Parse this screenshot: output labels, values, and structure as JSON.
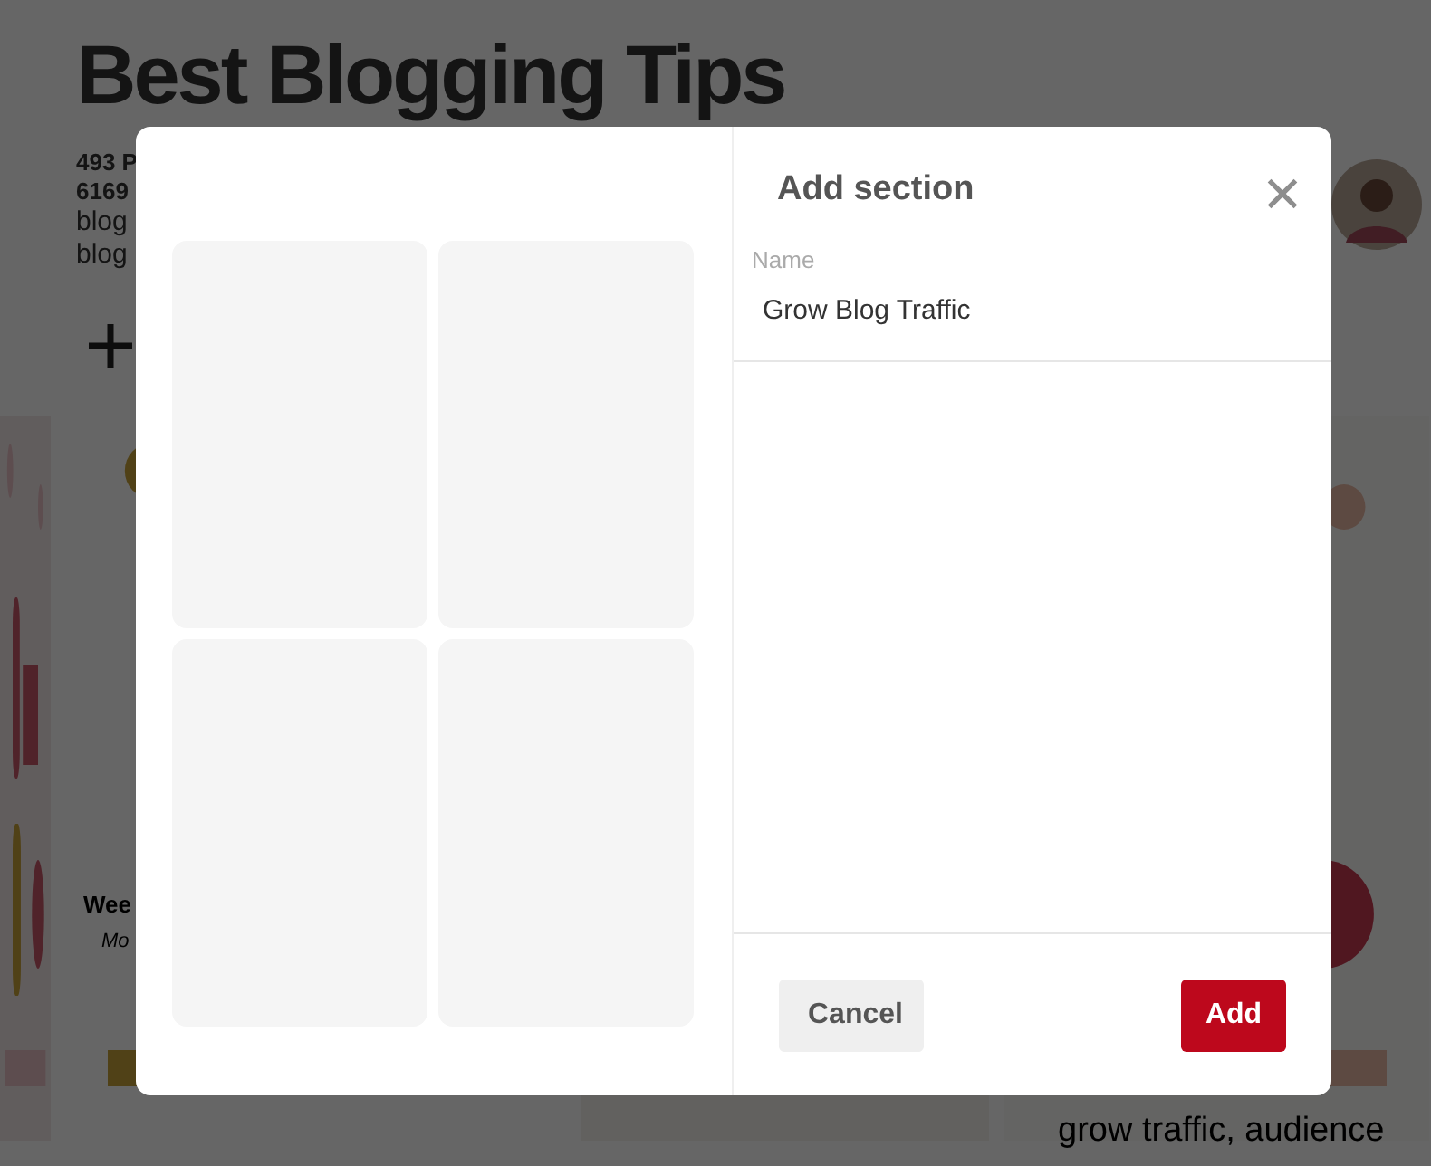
{
  "board": {
    "title": "Best Blogging Tips",
    "stats": [
      "493 P",
      "6169"
    ],
    "description_lines": [
      "blog",
      "blog"
    ],
    "pins": [
      {
        "kind": "picture"
      },
      {
        "kind": "picture",
        "title": "Wee",
        "subtitle": "Mo"
      },
      {
        "kind": "picture"
      },
      {
        "kind": "picture",
        "caption": "grow traffic, audience"
      }
    ]
  },
  "modal": {
    "title": "Add section",
    "field": {
      "label": "Name",
      "value": "Grow Blog Traffic"
    },
    "buttons": [
      {
        "label": "Cancel",
        "kind": "secondary"
      },
      {
        "label": "Add",
        "kind": "primary"
      }
    ]
  }
}
